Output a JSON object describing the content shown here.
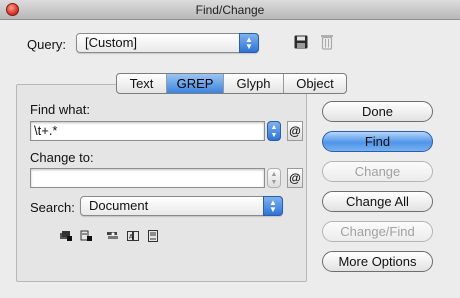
{
  "window": {
    "title": "Find/Change"
  },
  "query": {
    "label": "Query:",
    "value": "[Custom]"
  },
  "tabs": [
    {
      "label": "Text",
      "active": false
    },
    {
      "label": "GREP",
      "active": true
    },
    {
      "label": "Glyph",
      "active": false
    },
    {
      "label": "Object",
      "active": false
    }
  ],
  "find": {
    "label": "Find what:",
    "value": "\\t+.*"
  },
  "change": {
    "label": "Change to:",
    "value": ""
  },
  "search": {
    "label": "Search:",
    "value": "Document"
  },
  "buttons": {
    "done": "Done",
    "find": "Find",
    "change": "Change",
    "change_all": "Change All",
    "change_find": "Change/Find",
    "more_options": "More Options"
  },
  "icons": {
    "close": "close-icon",
    "save": "save-query-icon",
    "trash": "delete-query-icon",
    "special_char": "special-characters-icon"
  },
  "colors": {
    "accent": "#3b84e0"
  }
}
